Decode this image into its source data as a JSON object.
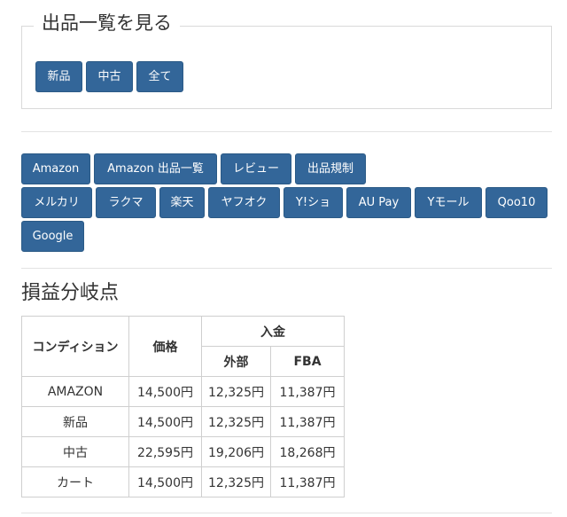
{
  "listing": {
    "title": "出品一覧を見る",
    "buttons": [
      "新品",
      "中古",
      "全て"
    ]
  },
  "links": {
    "row1": [
      "Amazon",
      "Amazon 出品一覧",
      "レビュー",
      "出品規制"
    ],
    "row2": [
      "メルカリ",
      "ラクマ",
      "楽天",
      "ヤフオク",
      "Y!ショ",
      "AU Pay",
      "Yモール",
      "Qoo10"
    ],
    "row3": [
      "Google"
    ]
  },
  "breakeven": {
    "title": "損益分岐点",
    "headers": {
      "condition": "コンディション",
      "price": "価格",
      "deposit": "入金",
      "external": "外部",
      "fba": "FBA"
    },
    "rows": [
      {
        "condition": "AMAZON",
        "price": "14,500円",
        "external": "12,325円",
        "fba": "11,387円"
      },
      {
        "condition": "新品",
        "price": "14,500円",
        "external": "12,325円",
        "fba": "11,387円"
      },
      {
        "condition": "中古",
        "price": "22,595円",
        "external": "19,206円",
        "fba": "18,268円"
      },
      {
        "condition": "カート",
        "price": "14,500円",
        "external": "12,325円",
        "fba": "11,387円"
      }
    ]
  },
  "colors": {
    "button_bg": "#336699",
    "button_text": "#ffffff",
    "border": "#d9d9d9"
  }
}
